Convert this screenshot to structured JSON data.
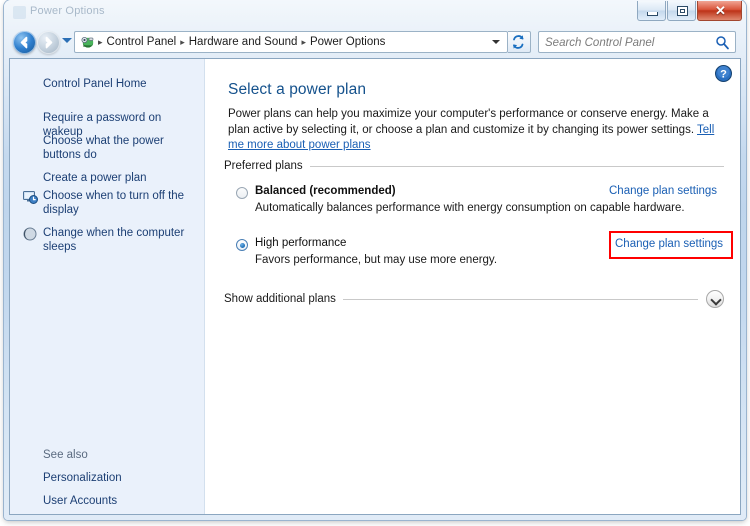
{
  "window": {
    "title": "Power Options",
    "buttons": {
      "minimize": "minimize",
      "maximize": "maximize",
      "close": "✕"
    }
  },
  "navbar": {
    "back": "back",
    "forward": "forward",
    "breadcrumb": [
      "Control Panel",
      "Hardware and Sound",
      "Power Options"
    ],
    "separator": "▸",
    "refresh": "refresh",
    "search": {
      "placeholder": "Search Control Panel",
      "value": ""
    }
  },
  "sidebar": {
    "home": "Control Panel Home",
    "items": [
      {
        "label": "Require a password on wakeup",
        "icon": ""
      },
      {
        "label": "Choose what the power buttons do",
        "icon": ""
      },
      {
        "label": "Create a power plan",
        "icon": ""
      },
      {
        "label": "Choose when to turn off the display",
        "icon": "monitor-clock-icon"
      },
      {
        "label": "Change when the computer sleeps",
        "icon": "moon-icon"
      }
    ],
    "see_also_label": "See also",
    "see_also": [
      "Personalization",
      "User Accounts"
    ]
  },
  "content": {
    "help": "?",
    "title": "Select a power plan",
    "description_part1": "Power plans can help you maximize your computer's performance or conserve energy. Make a plan active by selecting it, or choose a plan and customize it by changing its power settings. ",
    "description_link": "Tell me more about power plans",
    "preferred_plans_label": "Preferred plans",
    "plans": [
      {
        "name": "Balanced (recommended)",
        "description": "Automatically balances performance with energy consumption on capable hardware.",
        "selected": false,
        "bold": true,
        "change_link": "Change plan settings",
        "highlighted": false
      },
      {
        "name": "High performance",
        "description": "Favors performance, but may use more energy.",
        "selected": true,
        "bold": false,
        "change_link": "Change plan settings",
        "highlighted": true
      }
    ],
    "show_additional_plans": "Show additional plans",
    "chevron": "chevron-down-icon"
  },
  "colors": {
    "accent_link": "#1a5fb4",
    "title_blue": "#14518c",
    "sidebar_bg": "#eaf1fb",
    "highlight_red": "#ff0000",
    "close_red": "#bd3318"
  }
}
